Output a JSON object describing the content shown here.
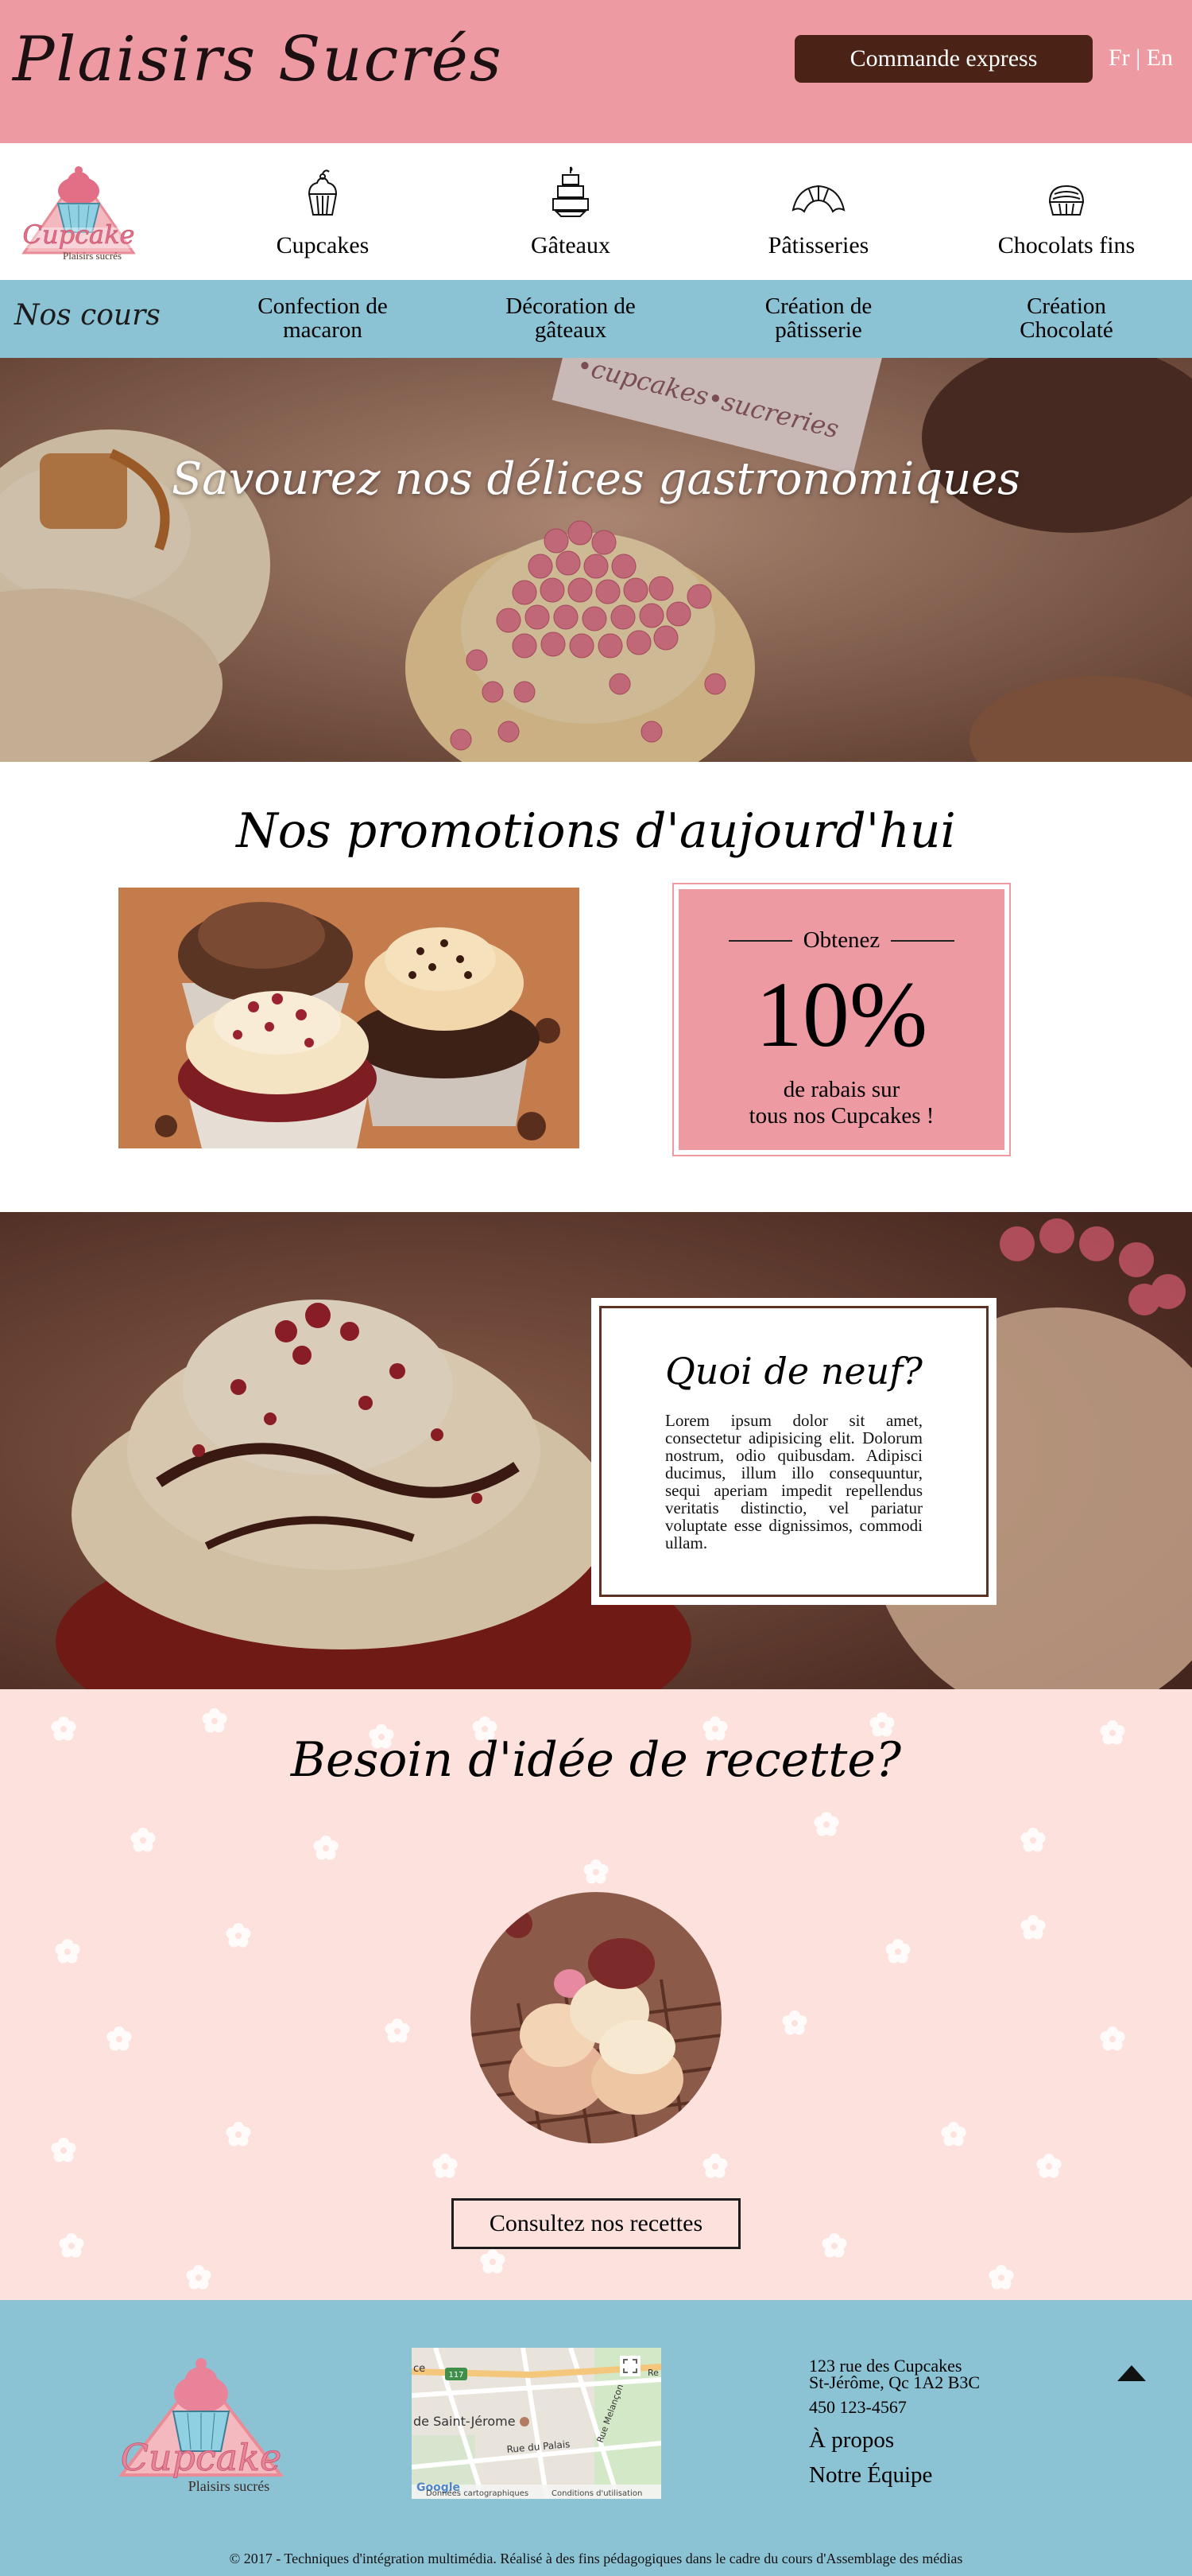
{
  "header": {
    "brand": "Plaisirs Sucrés",
    "express_label": "Commande express",
    "lang_fr": "Fr",
    "lang_sep": "|",
    "lang_en": "En"
  },
  "logo": {
    "name": "Cupcake",
    "tagline": "Plaisirs sucrés"
  },
  "categories": [
    {
      "label": "Cupcakes",
      "icon": "cupcake-icon"
    },
    {
      "label": "Gâteaux",
      "icon": "cake-icon"
    },
    {
      "label": "Pâtisseries",
      "icon": "croissant-icon"
    },
    {
      "label": "Chocolats fins",
      "icon": "chocolate-icon"
    }
  ],
  "courses": {
    "title": "Nos cours",
    "items": [
      {
        "line1": "Confection de",
        "line2": "macaron"
      },
      {
        "line1": "Décoration de",
        "line2": "gâteaux"
      },
      {
        "line1": "Création de",
        "line2": "pâtisserie"
      },
      {
        "line1": "Création",
        "line2": "Chocolaté"
      }
    ]
  },
  "hero": {
    "tagline": "Savourez nos délices gastronomiques",
    "card_text": "•cupcakes•sucreries"
  },
  "promotions": {
    "title": "Nos promotions d'aujourd'hui",
    "obtenez": "Obtenez",
    "percent": "10%",
    "line1": "de rabais sur",
    "line2": "tous nos Cupcakes !"
  },
  "news": {
    "title": "Quoi de neuf?",
    "text": "Lorem ipsum dolor sit amet, consectetur adipisicing elit. Dolorum nostrum, odio quibusdam. Adipisci ducimus, illum illo consequuntur, sequi aperiam impedit repellendus veritatis distinctio, vel pariatur voluptate esse dignissimos, commodi ullam."
  },
  "recipes": {
    "title": "Besoin d'idée de recette?",
    "button": "Consultez nos recettes"
  },
  "footer": {
    "address_line1": "123 rue des Cupcakes",
    "address_line2": "St-Jérôme, Qc 1A2 B3C",
    "phone": "450 123-4567",
    "about": "À propos",
    "team": "Notre Équipe",
    "copyright": "© 2017 - Techniques d'intégration multimédia. Réalisé à des fins pédagogiques dans le cadre du cours d'Assemblage des médias",
    "map": {
      "city": "de Saint-Jérome",
      "street1": "Rue du Palais",
      "street2": "Rue Melançon",
      "route": "117",
      "prefix": "ce",
      "edge": "Re",
      "google": "Google",
      "data_label": "Données cartographiques",
      "terms_label": "Conditions d'utilisation"
    }
  },
  "colors": {
    "pink": "#ed9aa3",
    "brown": "#4b2316",
    "blue": "#8bc3d5",
    "blush": "#fde1dc"
  }
}
